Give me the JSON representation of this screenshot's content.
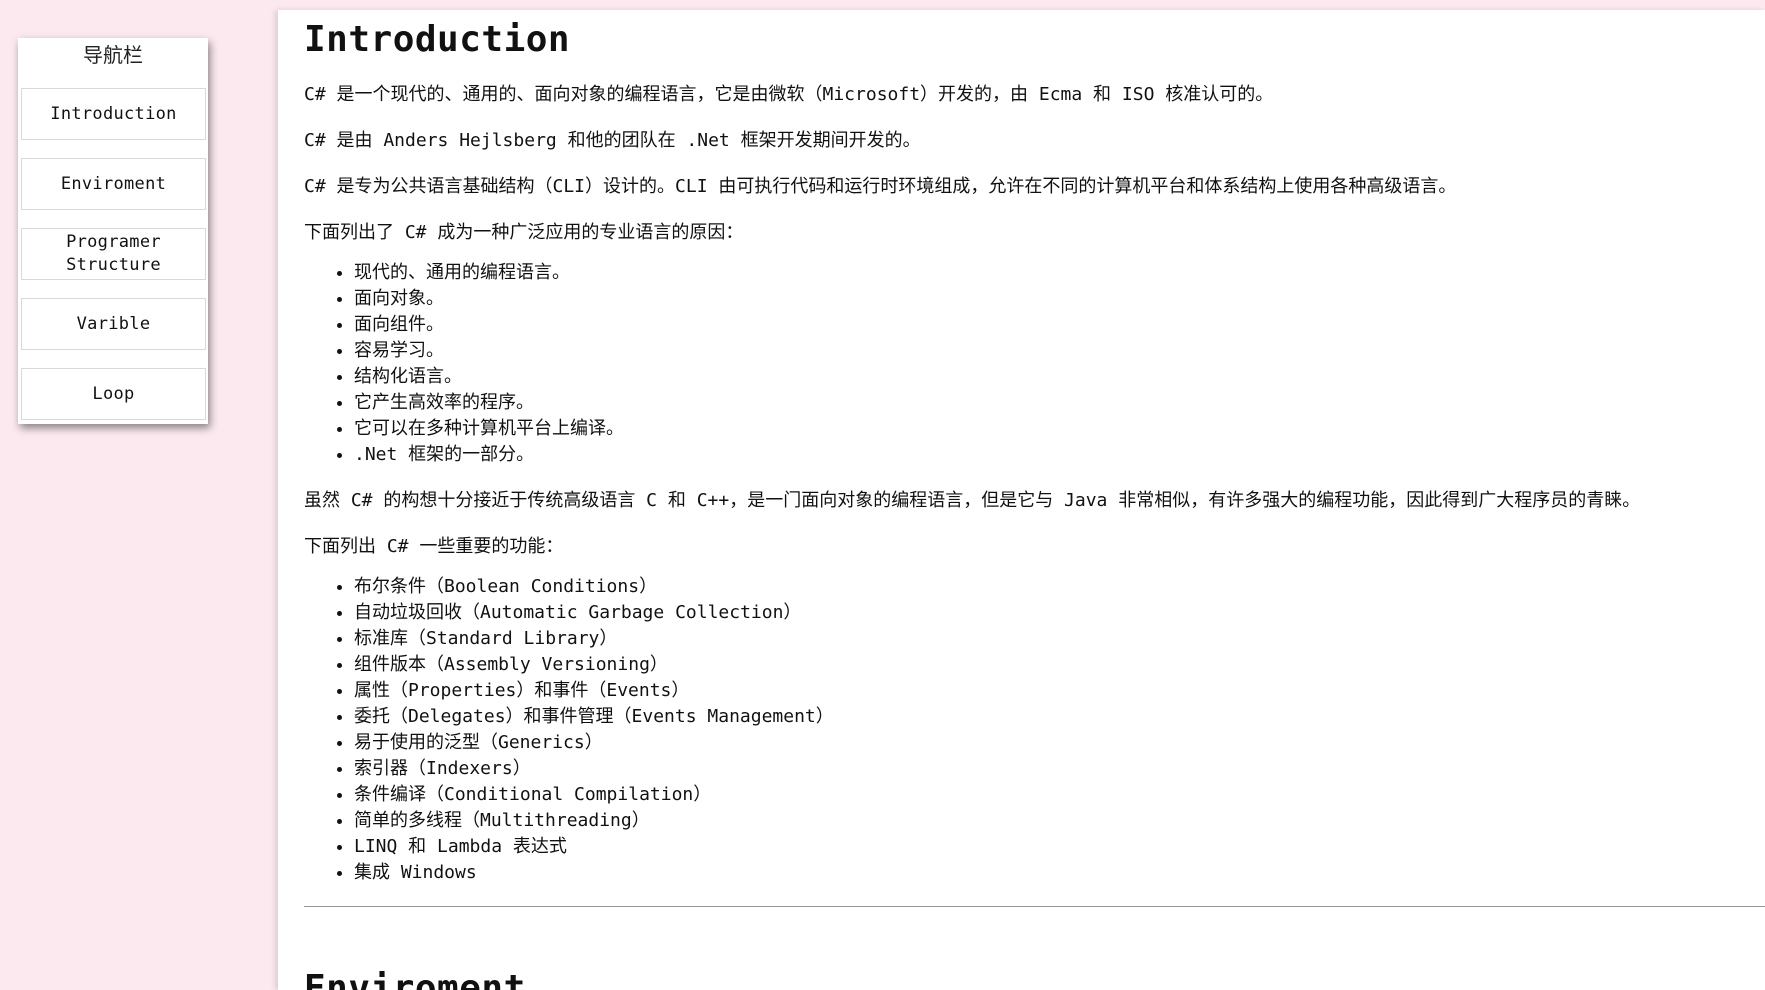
{
  "sidebar": {
    "title": "导航栏",
    "items": [
      {
        "label": "Introduction"
      },
      {
        "label": "Enviroment"
      },
      {
        "label": "Programer\nStructure"
      },
      {
        "label": "Varible"
      },
      {
        "label": "Loop"
      }
    ]
  },
  "main": {
    "heading": "Introduction",
    "paragraphs": [
      "C# 是一个现代的、通用的、面向对象的编程语言，它是由微软（Microsoft）开发的，由 Ecma 和 ISO 核准认可的。",
      "C# 是由 Anders Hejlsberg 和他的团队在 .Net 框架开发期间开发的。",
      "C# 是专为公共语言基础结构（CLI）设计的。CLI 由可执行代码和运行时环境组成，允许在不同的计算机平台和体系结构上使用各种高级语言。",
      "下面列出了 C# 成为一种广泛应用的专业语言的原因：",
      "虽然 C# 的构想十分接近于传统高级语言 C 和 C++，是一门面向对象的编程语言，但是它与 Java 非常相似，有许多强大的编程功能，因此得到广大程序员的青睐。",
      "下面列出 C# 一些重要的功能："
    ],
    "reasons": [
      "现代的、通用的编程语言。",
      "面向对象。",
      "面向组件。",
      "容易学习。",
      "结构化语言。",
      "它产生高效率的程序。",
      "它可以在多种计算机平台上编译。",
      ".Net 框架的一部分。"
    ],
    "features": [
      "布尔条件（Boolean Conditions）",
      "自动垃圾回收（Automatic Garbage Collection）",
      "标准库（Standard Library）",
      "组件版本（Assembly Versioning）",
      "属性（Properties）和事件（Events）",
      "委托（Delegates）和事件管理（Events Management）",
      "易于使用的泛型（Generics）",
      "索引器（Indexers）",
      "条件编译（Conditional Compilation）",
      "简单的多线程（Multithreading）",
      "LINQ 和 Lambda 表达式",
      "集成 Windows"
    ],
    "next_heading": "Enviroment"
  },
  "colors": {
    "page_background": "#fbe9ef",
    "content_background": "#ffffff",
    "sidebar_background": "#ffffff"
  }
}
